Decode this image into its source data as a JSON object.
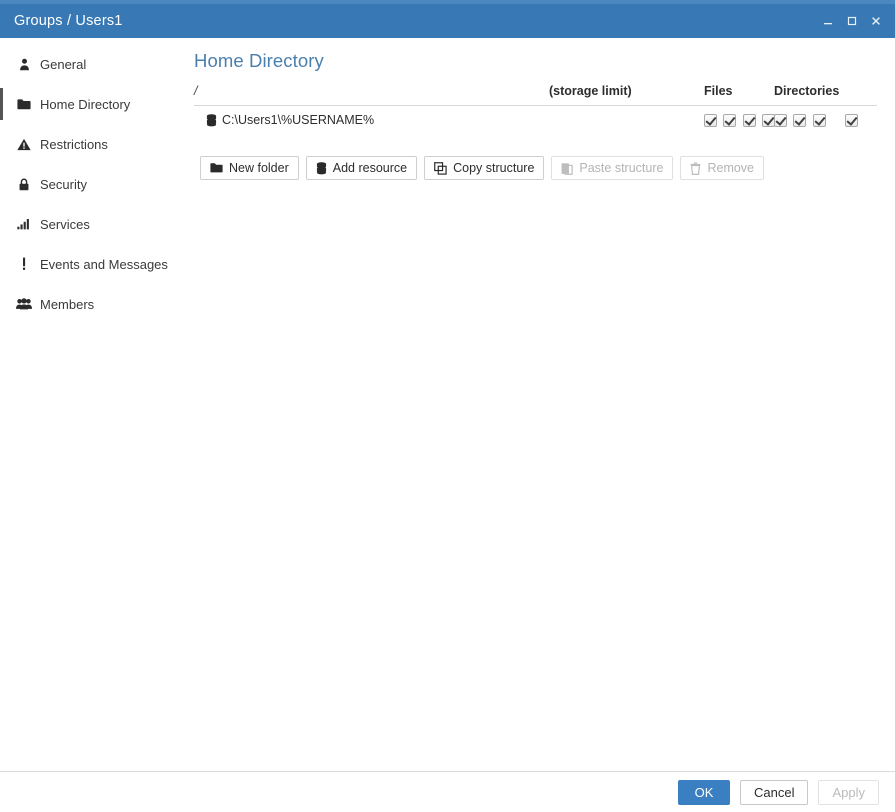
{
  "window": {
    "title": "Groups / Users1",
    "controls": [
      {
        "name": "minimize-button",
        "glyph": "minimize"
      },
      {
        "name": "maximize-button",
        "glyph": "maximize"
      },
      {
        "name": "close-button",
        "glyph": "close"
      }
    ],
    "titlebar_color": "#3778b5"
  },
  "sidebar": {
    "items": [
      {
        "label": "General",
        "icon": "user-icon",
        "selected": false
      },
      {
        "label": "Home Directory",
        "icon": "folder-icon",
        "selected": true
      },
      {
        "label": "Restrictions",
        "icon": "warning-triangle-icon",
        "selected": false
      },
      {
        "label": "Security",
        "icon": "lock-icon",
        "selected": false
      },
      {
        "label": "Services",
        "icon": "signal-bars-icon",
        "selected": false
      },
      {
        "label": "Events and Messages",
        "icon": "exclamation-icon",
        "selected": false
      },
      {
        "label": "Members",
        "icon": "users-group-icon",
        "selected": false
      }
    ]
  },
  "main": {
    "page_title": "Home Directory",
    "title_color": "#4a7fae",
    "table": {
      "headers": {
        "path": "/",
        "storage_limit": "(storage limit)",
        "files": "Files",
        "directories": "Directories"
      },
      "rows": [
        {
          "path": "C:\\Users1\\%USERNAME%",
          "icon": "database-stack-icon",
          "storage_limit": "",
          "files": [
            true,
            true,
            true,
            true
          ],
          "directories": [
            true,
            true,
            true,
            true
          ]
        }
      ]
    },
    "toolbar": [
      {
        "label": "New folder",
        "icon": "folder-icon",
        "disabled": false
      },
      {
        "label": "Add resource",
        "icon": "database-stack-icon",
        "disabled": false
      },
      {
        "label": "Copy structure",
        "icon": "copy-icon",
        "disabled": false
      },
      {
        "label": "Paste structure",
        "icon": "paste-icon",
        "disabled": true
      },
      {
        "label": "Remove",
        "icon": "trash-icon",
        "disabled": true
      }
    ]
  },
  "footer": {
    "ok_label": "OK",
    "cancel_label": "Cancel",
    "apply_label": "Apply",
    "ok_color": "#3a7fc1"
  }
}
